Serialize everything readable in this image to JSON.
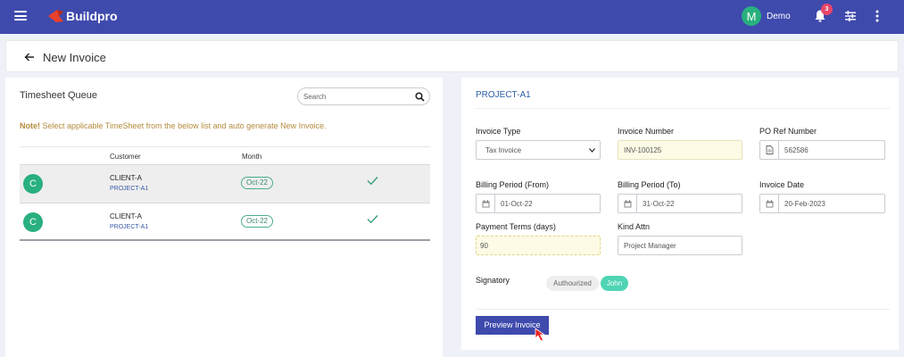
{
  "app": {
    "brand": "Buildpro",
    "user_initial": "M",
    "user_name": "Demo",
    "notifications": "3"
  },
  "page": {
    "title": "New Invoice"
  },
  "queue": {
    "title": "Timesheet Queue",
    "search_placeholder": "Search",
    "note_bold": "Note!",
    "note_text": " Select applicable TimeSheet from the below list and auto generate New Invoice.",
    "columns": {
      "customer": "Customer",
      "month": "Month"
    },
    "rows": [
      {
        "initial": "C",
        "customer": "CLIENT-A",
        "project": "PROJECT-A1",
        "month": "Oct-22",
        "selected": true
      },
      {
        "initial": "C",
        "customer": "CLIENT-A",
        "project": "PROJECT-A1",
        "month": "Oct-22",
        "selected": false
      }
    ]
  },
  "form": {
    "project": "PROJECT-A1",
    "invoice_type": {
      "label": "Invoice Type",
      "value": "Tax Invoice"
    },
    "invoice_number": {
      "label": "Invoice Number",
      "value": "INV-100125"
    },
    "po_ref": {
      "label": "PO Ref Number",
      "value": "562586"
    },
    "billing_from": {
      "label": "Billing Period (From)",
      "value": "01-Oct-22"
    },
    "billing_to": {
      "label": "Billing Period (To)",
      "value": "31-Oct-22"
    },
    "invoice_date": {
      "label": "Invoice Date",
      "value": "20-Feb-2023"
    },
    "payment_terms": {
      "label": "Payment Terms (days)",
      "value": "90"
    },
    "kind_attn": {
      "label": "Kind Attn",
      "value": "Project Manager"
    },
    "signatory": {
      "label": "Signatory",
      "options": [
        "Authourized",
        "John"
      ],
      "selected": "John"
    },
    "preview_button": "Preview Invoice"
  },
  "colors": {
    "topbar": "#3f4aad",
    "accent_green": "#28b07e",
    "chip_green": "#4fd4b4",
    "badge": "#e8466a",
    "note": "#b48b3c"
  },
  "icons": [
    "hamburger-icon",
    "logo-icon",
    "bell-icon",
    "sliders-icon",
    "kebab-icon",
    "back-arrow-icon",
    "search-icon",
    "check-icon",
    "calendar-icon",
    "document-icon",
    "cursor-icon"
  ]
}
